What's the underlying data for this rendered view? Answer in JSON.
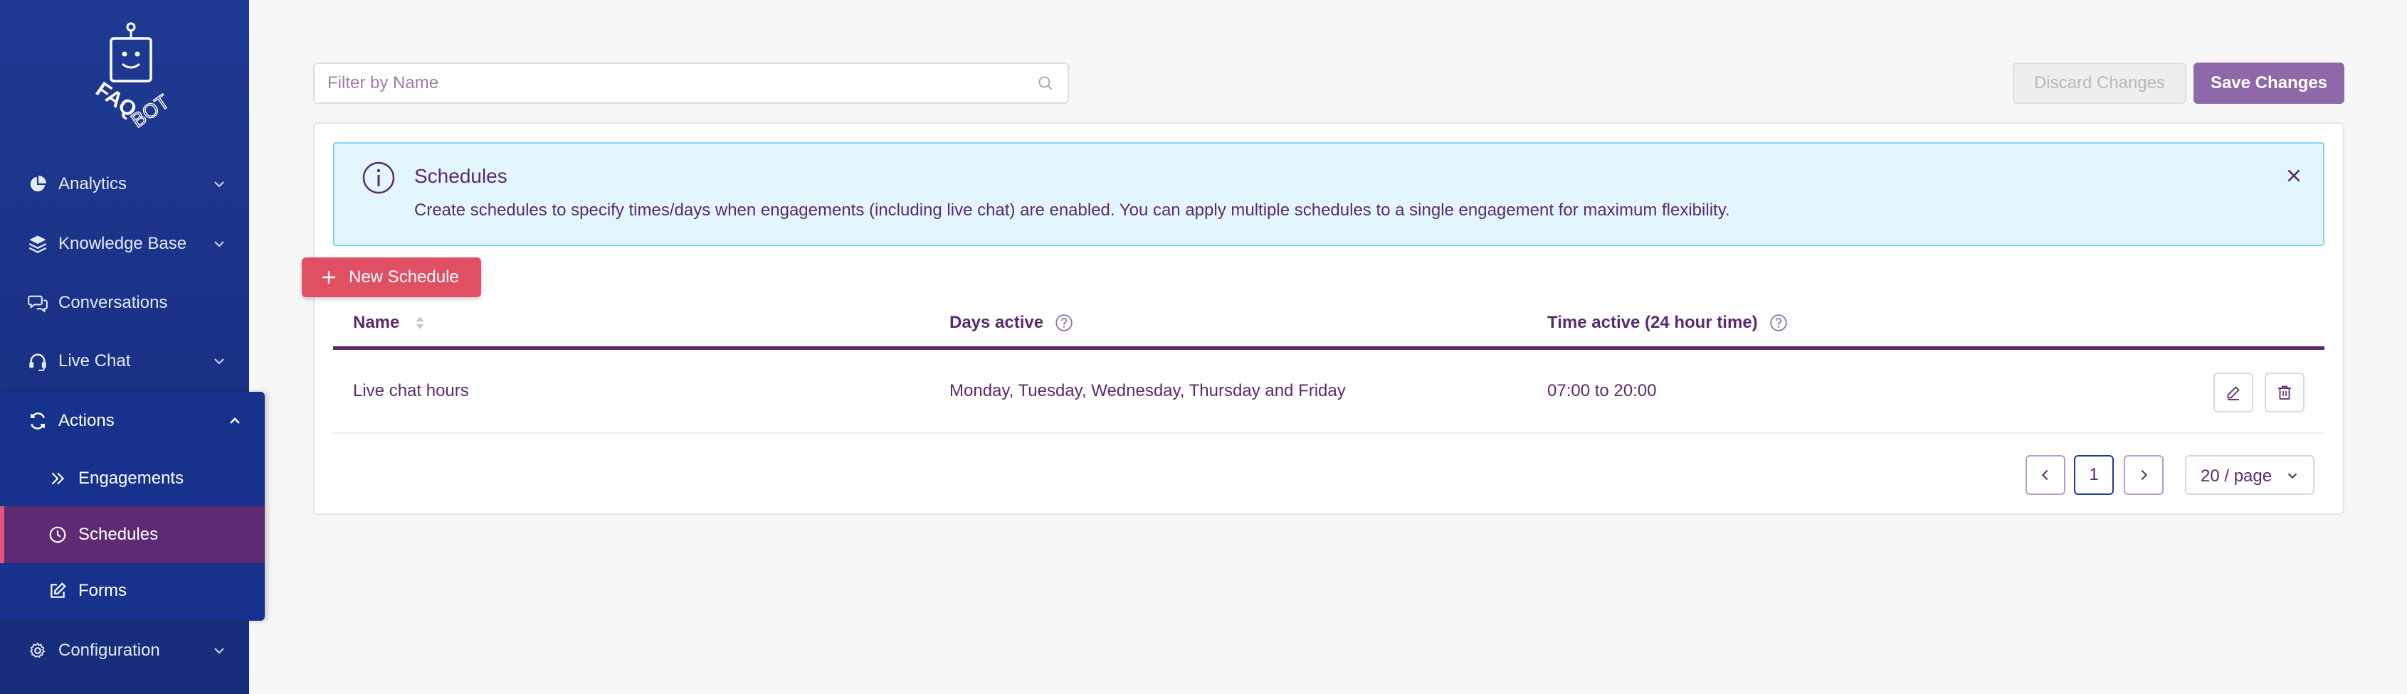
{
  "brand": {
    "logo_text": "FAQ BOT"
  },
  "sidebar": {
    "items": [
      {
        "label": "Analytics",
        "icon": "pie-chart-icon",
        "expandable": true
      },
      {
        "label": "Knowledge Base",
        "icon": "layers-icon",
        "expandable": true
      },
      {
        "label": "Conversations",
        "icon": "chat-bubbles-icon",
        "expandable": false
      },
      {
        "label": "Live Chat",
        "icon": "headset-icon",
        "expandable": true
      },
      {
        "label": "Actions",
        "icon": "sync-icon",
        "expandable": true,
        "expanded": true
      },
      {
        "label": "Configuration",
        "icon": "gear-icon",
        "expandable": true
      }
    ],
    "subitems": [
      {
        "label": "Engagements",
        "icon": "double-chevron-icon"
      },
      {
        "label": "Schedules",
        "icon": "clock-icon",
        "active": true
      },
      {
        "label": "Forms",
        "icon": "edit-form-icon"
      }
    ]
  },
  "toolbar": {
    "filter_placeholder": "Filter by Name",
    "filter_value": "",
    "discard_label": "Discard Changes",
    "save_label": "Save Changes"
  },
  "alert": {
    "title": "Schedules",
    "description": "Create schedules to specify times/days when engagements (including live chat) are enabled. You can apply multiple schedules to a single engagement for maximum flexibility."
  },
  "new_schedule_label": "New Schedule",
  "table": {
    "columns": [
      "Name",
      "Days active",
      "Time active (24 hour time)"
    ],
    "rows": [
      {
        "name": "Live chat hours",
        "days": "Monday, Tuesday, Wednesday, Thursday and Friday",
        "time": "07:00 to 20:00"
      }
    ]
  },
  "pagination": {
    "current_page": "1",
    "page_size": "20 / page"
  },
  "colors": {
    "sidebar": "#1f3a93",
    "active_item": "#5e2b72",
    "accent_red": "#e14f63",
    "primary_purple": "#8e68a8",
    "text_purple": "#5a2a6e",
    "alert_bg": "#e4f6fd"
  }
}
